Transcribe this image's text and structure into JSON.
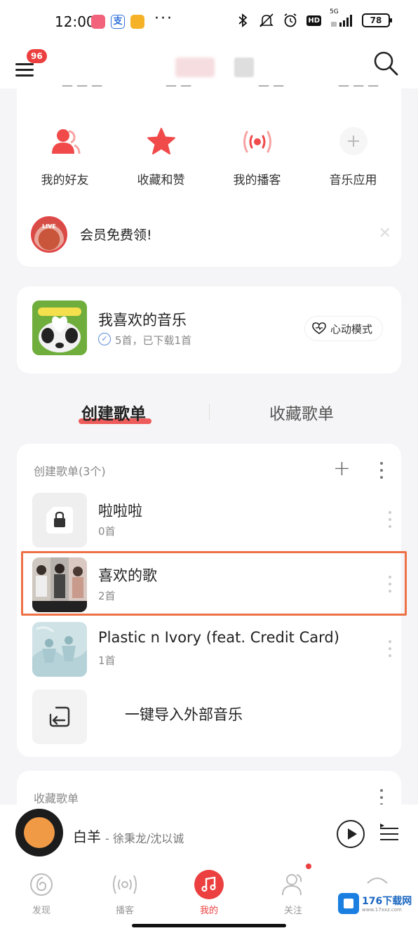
{
  "status_bar": {
    "time": "12:00",
    "more": "···",
    "battery": "78",
    "hd": "HD",
    "network": "5G"
  },
  "header": {
    "menu_badge": "96"
  },
  "shortcuts": [
    {
      "label": "我的好友",
      "icon": "friends-icon"
    },
    {
      "label": "收藏和赞",
      "icon": "star-icon"
    },
    {
      "label": "我的播客",
      "icon": "podcast-icon"
    },
    {
      "label": "音乐应用",
      "icon": "plus-icon"
    }
  ],
  "vip": {
    "label": "会员免费领!",
    "avatar_text": "LIVE"
  },
  "favorites": {
    "title": "我喜欢的音乐",
    "subtitle": "5首，已下载1首",
    "mode_button": "心动模式"
  },
  "tabs": {
    "active": "创建歌单",
    "inactive": "收藏歌单"
  },
  "created_section": {
    "header": "创建歌单(3个)",
    "playlists": [
      {
        "name": "啦啦啦",
        "count": "0首",
        "cover": "locked"
      },
      {
        "name": "喜欢的歌",
        "count": "2首",
        "cover": "photo"
      },
      {
        "name": "Plastic n Ivory (feat. Credit Card)",
        "count": "1首",
        "cover": "art"
      }
    ],
    "import_label": "一键导入外部音乐"
  },
  "collected_section": {
    "header": "收藏歌单"
  },
  "player": {
    "title": "白羊",
    "artist": "- 徐秉龙/沈以诚"
  },
  "bottom_nav": [
    {
      "label": "发现",
      "icon": "discover-icon"
    },
    {
      "label": "播客",
      "icon": "podcast-icon"
    },
    {
      "label": "我的",
      "icon": "music-note-icon",
      "active": true
    },
    {
      "label": "关注",
      "icon": "follow-icon"
    }
  ],
  "watermark": {
    "text": "176下载网",
    "sub": "www.17xxz.com"
  },
  "colors": {
    "accent": "#ec3f3f",
    "highlight": "#ee7146"
  }
}
